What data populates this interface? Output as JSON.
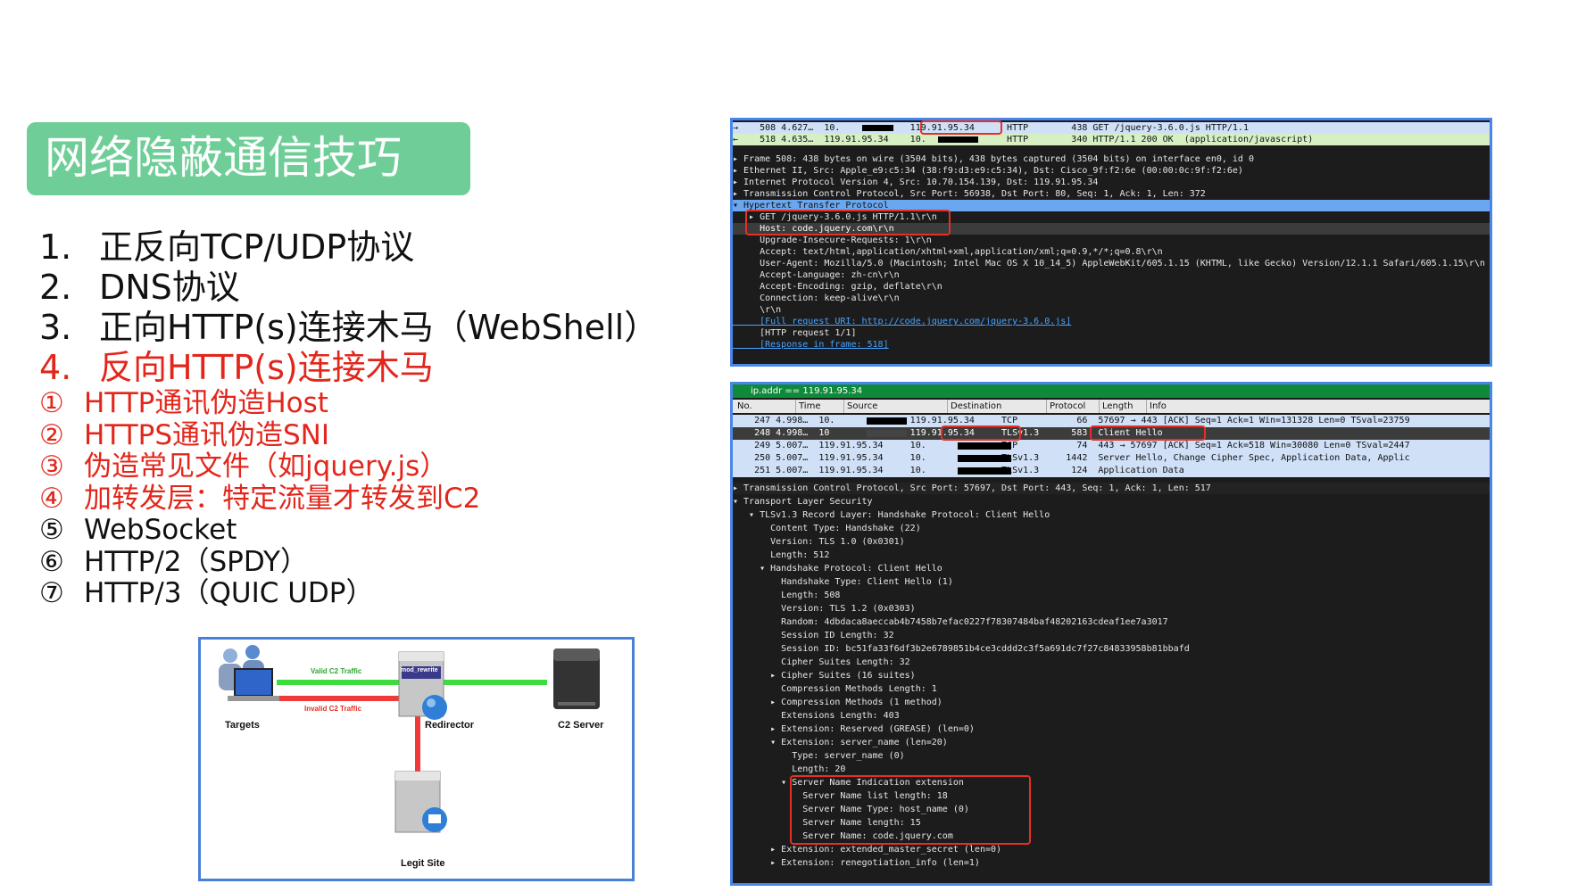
{
  "title": "网络隐蔽通信技巧",
  "outline": [
    {
      "num": "1.",
      "text": "正反向TCP/UDP协议",
      "active": false
    },
    {
      "num": "2.",
      "text": "DNS协议",
      "active": false
    },
    {
      "num": "3.",
      "text": "正向HTTP(s)连接木马（WebShell）",
      "active": false
    },
    {
      "num": "4.",
      "text": "反向HTTP(s)连接木马",
      "active": true
    }
  ],
  "sub_items": [
    {
      "mark": "①",
      "text": "HTTP通讯伪造Host",
      "red": true
    },
    {
      "mark": "②",
      "text": "HTTPS通讯伪造SNI",
      "red": true
    },
    {
      "mark": "③",
      "text": "伪造常见文件（如jquery.js）",
      "red": true
    },
    {
      "mark": "④",
      "text": "加转发层：特定流量才转发到C2",
      "red": true
    },
    {
      "mark": "⑤",
      "text": "WebSocket",
      "red": false
    },
    {
      "mark": "⑥",
      "text": "HTTP/2（SPDY）",
      "red": false
    },
    {
      "mark": "⑦",
      "text": "HTTP/3（QUIC UDP）",
      "red": false
    }
  ],
  "diagram": {
    "targets": "Targets",
    "redirector": "Redirector",
    "c2_server": "C2 Server",
    "legit_site": "Legit Site",
    "valid_traffic": "Valid C2 Traffic",
    "invalid_traffic": "Invalid C2 Traffic",
    "rewrite_label": "mod_rewrite",
    "colors": {
      "valid": "#3ddc3d",
      "invalid": "#f03a3a"
    }
  },
  "ws1": {
    "packets": [
      "→    508 4.627…  10.             119.91.95.34      HTTP        438 GET /jquery-3.6.0.js HTTP/1.1",
      "←    518 4.635…  119.91.95.34    10.               HTTP        340 HTTP/1.1 200 OK  (application/javascript)"
    ],
    "details": [
      "▸ Frame 508: 438 bytes on wire (3504 bits), 438 bytes captured (3504 bits) on interface en0, id 0",
      "▸ Ethernet II, Src: Apple_e9:c5:34 (38:f9:d3:e9:c5:34), Dst: Cisco_9f:f2:6e (00:00:0c:9f:f2:6e)",
      "▸ Internet Protocol Version 4, Src: 10.70.154.139, Dst: 119.91.95.34",
      "▸ Transmission Control Protocol, Src Port: 56938, Dst Port: 80, Seq: 1, Ack: 1, Len: 372",
      "▾ Hypertext Transfer Protocol",
      "   ▸ GET /jquery-3.6.0.js HTTP/1.1\\r\\n",
      "     Host: code.jquery.com\\r\\n",
      "     Upgrade-Insecure-Requests: 1\\r\\n",
      "     Accept: text/html,application/xhtml+xml,application/xml;q=0.9,*/*;q=0.8\\r\\n",
      "     User-Agent: Mozilla/5.0 (Macintosh; Intel Mac OS X 10_14_5) AppleWebKit/605.1.15 (KHTML, like Gecko) Version/12.1.1 Safari/605.1.15\\r\\n",
      "     Accept-Language: zh-cn\\r\\n",
      "     Accept-Encoding: gzip, deflate\\r\\n",
      "     Connection: keep-alive\\r\\n",
      "     \\r\\n",
      "     [Full request URI: http://code.jquery.com/jquery-3.6.0.js]",
      "     [HTTP request 1/1]",
      "     [Response in frame: 518]"
    ]
  },
  "ws2": {
    "filter": "ip.addr == 119.91.95.34",
    "columns": [
      "No.",
      "Time",
      "Source",
      "Destination",
      "Protocol",
      "Length",
      "Info"
    ],
    "packets": [
      "    247 4.998…  10.              119.91.95.34     TCP           66  57697 → 443 [ACK] Seq=1 Ack=1 Win=131328 Len=0 TSval=23759",
      "    248 4.998…  10               119.91.95.34     TLSv1.3      583  Client Hello",
      "    249 5.007…  119.91.95.34     10.              TCP           74  443 → 57697 [ACK] Seq=1 Ack=518 Win=30080 Len=0 TSval=2447",
      "    250 5.007…  119.91.95.34     10.              TLSv1.3     1442  Server Hello, Change Cipher Spec, Application Data, Applic",
      "    251 5.007…  119.91.95.34     10.              TLSv1.3      124  Application Data"
    ],
    "details": [
      "▸ Transmission Control Protocol, Src Port: 57697, Dst Port: 443, Seq: 1, Ack: 1, Len: 517",
      "▾ Transport Layer Security",
      "   ▾ TLSv1.3 Record Layer: Handshake Protocol: Client Hello",
      "       Content Type: Handshake (22)",
      "       Version: TLS 1.0 (0x0301)",
      "       Length: 512",
      "     ▾ Handshake Protocol: Client Hello",
      "         Handshake Type: Client Hello (1)",
      "         Length: 508",
      "         Version: TLS 1.2 (0x0303)",
      "         Random: 4dbdaca8aeccab4b7458b7efac0227f78307484baf48202163cdeaf1ee7a3017",
      "         Session ID Length: 32",
      "         Session ID: bc51fa33f6df3b2e6789851b4ce3cddd2c3f5a691dc7f27c84833958b81bbafd",
      "         Cipher Suites Length: 32",
      "       ▸ Cipher Suites (16 suites)",
      "         Compression Methods Length: 1",
      "       ▸ Compression Methods (1 method)",
      "         Extensions Length: 403",
      "       ▸ Extension: Reserved (GREASE) (len=0)",
      "       ▾ Extension: server_name (len=20)",
      "           Type: server_name (0)",
      "           Length: 20",
      "         ▾ Server Name Indication extension",
      "             Server Name list length: 18",
      "             Server Name Type: host_name (0)",
      "             Server Name length: 15",
      "             Server Name: code.jquery.com",
      "       ▸ Extension: extended_master_secret (len=0)",
      "       ▸ Extension: renegotiation_info (len=1)"
    ]
  }
}
